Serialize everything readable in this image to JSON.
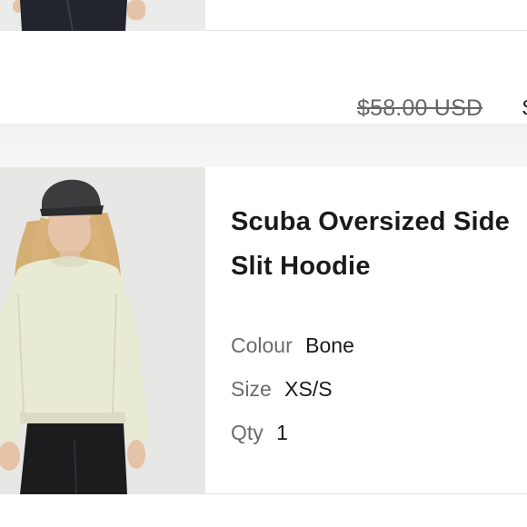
{
  "previous_item": {
    "price_original": "$58.00 USD",
    "price_next_char": "$"
  },
  "item": {
    "title_line1": "Scuba Oversized Side",
    "title_line2": "Slit Hoodie",
    "colour_label": "Colour",
    "colour_value": "Bone",
    "size_label": "Size",
    "size_value": "XS/S",
    "qty_label": "Qty",
    "qty_value": "1",
    "image_alt": "Model wearing bone Scuba oversized hoodie and dark cap"
  },
  "colors": {
    "hoodie": "#e9ead2",
    "cap": "#3b3b3d",
    "hair": "#d7b27a",
    "skin": "#e7c3a8",
    "leggings": "#1d1d20",
    "photo_bg": "#e8e8e6"
  }
}
